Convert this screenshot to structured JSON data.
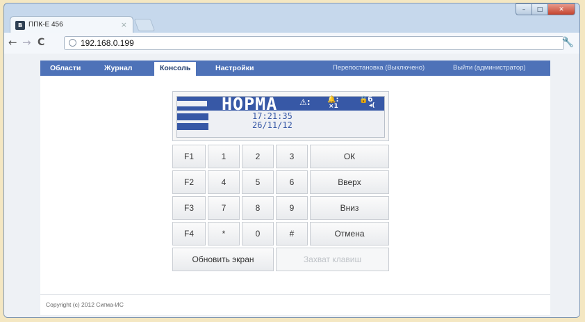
{
  "browser": {
    "tab_title": "ППК-Е 456",
    "tab_favicon": "В",
    "tab_close": "×",
    "url": "192.168.0.199",
    "back": "←",
    "forward": "→",
    "reload": "C",
    "wrench": "🔧",
    "window_buttons": {
      "minimize": "–",
      "maximize": "□",
      "close": "✕"
    }
  },
  "menu": {
    "items": [
      {
        "label": "Области"
      },
      {
        "label": "Журнал"
      },
      {
        "label": "Консоль"
      },
      {
        "label": "Настройки"
      }
    ],
    "active_index": 2,
    "rearm": "Перепостановка (Выключено)",
    "logout": "Выйти (администратор)"
  },
  "lcd": {
    "status": "НОРМА",
    "time": "17:21:35",
    "date": "26/11/12",
    "icons": {
      "alarm": "⚠:",
      "bell": "🔔:",
      "count": "×1",
      "lock": "🔒б",
      "sound": "◂("
    }
  },
  "keypad": {
    "rows": [
      {
        "f": "F1",
        "keys": [
          "1",
          "2",
          "3"
        ],
        "action": "ОК"
      },
      {
        "f": "F2",
        "keys": [
          "4",
          "5",
          "6"
        ],
        "action": "Вверх"
      },
      {
        "f": "F3",
        "keys": [
          "7",
          "8",
          "9"
        ],
        "action": "Вниз"
      },
      {
        "f": "F4",
        "keys": [
          "*",
          "0",
          "#"
        ],
        "action": "Отмена"
      }
    ],
    "refresh": "Обновить экран",
    "capture": "Захват клавиш"
  },
  "footer": {
    "copyright": "Copyright (c) 2012 Сигма-ИС"
  },
  "colors": {
    "menu_bg": "#4e72b8",
    "lcd_blue": "#3758a6",
    "desktop": "#f4e7c2"
  }
}
